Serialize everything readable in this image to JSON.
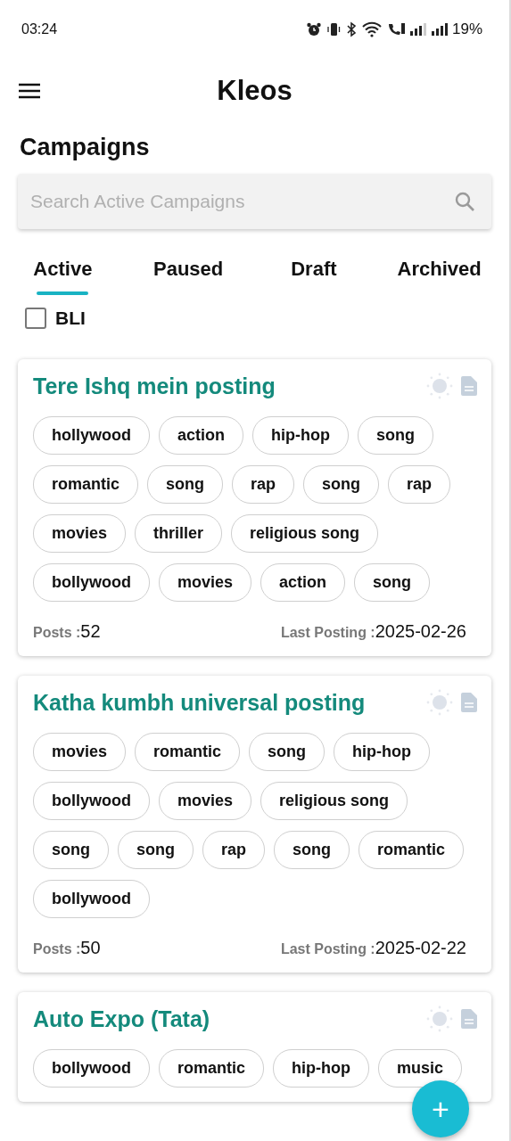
{
  "status_bar": {
    "time": "03:24",
    "battery": "19%"
  },
  "app_bar": {
    "title": "Kleos"
  },
  "page_title": "Campaigns",
  "search": {
    "placeholder": "Search Active Campaigns"
  },
  "tabs": [
    {
      "label": "Active",
      "selected": true
    },
    {
      "label": "Paused",
      "selected": false
    },
    {
      "label": "Draft",
      "selected": false
    },
    {
      "label": "Archived",
      "selected": false
    }
  ],
  "filter": {
    "label": "BLI",
    "checked": false
  },
  "campaigns": [
    {
      "title": "Tere Ishq mein posting",
      "tags": [
        "hollywood",
        "action",
        "hip-hop",
        "song",
        "romantic",
        "song",
        "rap",
        "song",
        "rap",
        "movies",
        "thriller",
        "religious song",
        "bollywood",
        "movies",
        "action",
        "song"
      ],
      "posts_label": "Posts :",
      "posts": "52",
      "last_label": "Last Posting :",
      "last": "2025-02-26"
    },
    {
      "title": "Katha kumbh universal posting",
      "tags": [
        "movies",
        "romantic",
        "song",
        "hip-hop",
        "bollywood",
        "movies",
        "religious song",
        "song",
        "song",
        "rap",
        "song",
        "romantic",
        "bollywood"
      ],
      "posts_label": "Posts :",
      "posts": "50",
      "last_label": "Last Posting :",
      "last": "2025-02-22"
    },
    {
      "title": "Auto Expo (Tata)",
      "tags": [
        "bollywood",
        "romantic",
        "hip-hop",
        "music"
      ]
    }
  ],
  "fab": {
    "label": "+"
  }
}
